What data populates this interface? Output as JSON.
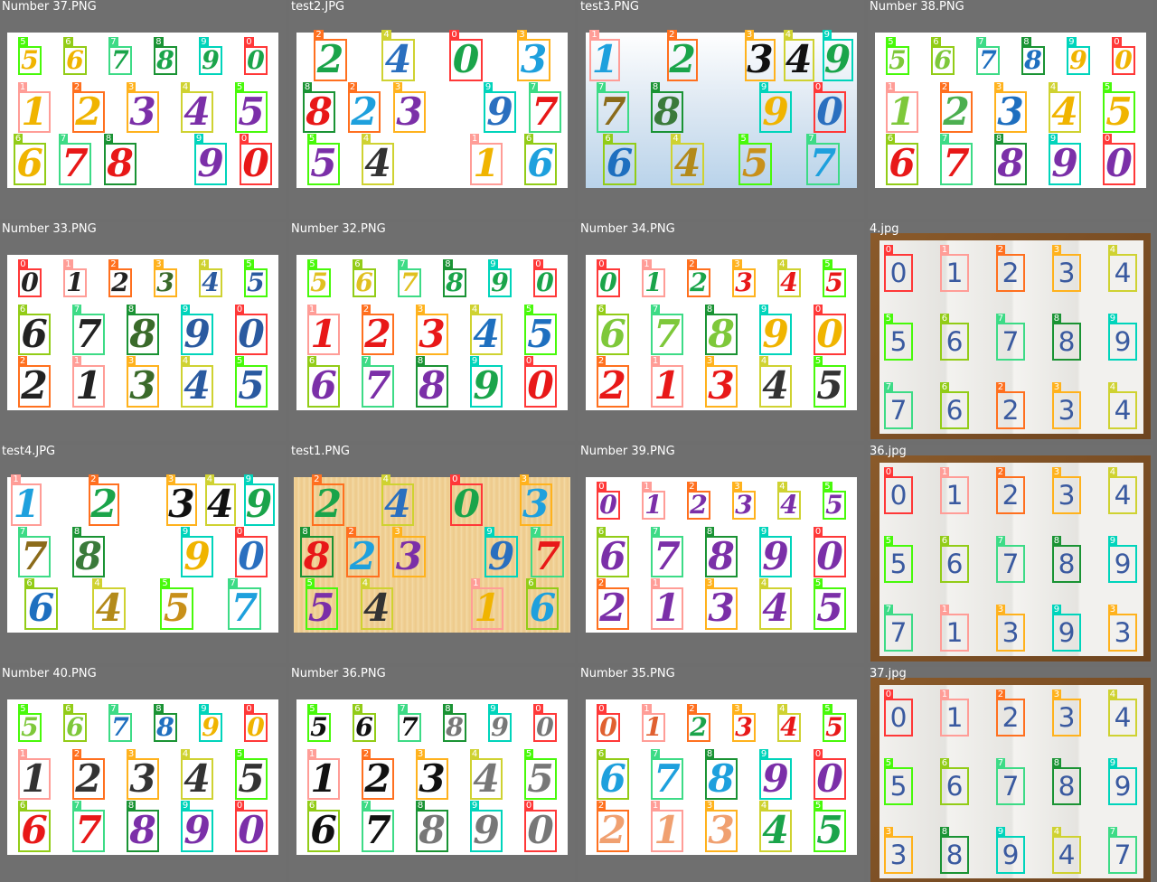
{
  "palette": {
    "0": "#ff3838",
    "1": "#ff9d97",
    "2": "#ff701f",
    "3": "#ffb21d",
    "4": "#cfd231",
    "5": "#48f90a",
    "6": "#92cc17",
    "7": "#3ddb86",
    "8": "#1a9334",
    "9": "#00d4bb"
  },
  "tiles": [
    {
      "title": "Number 37.PNG",
      "bg": "white",
      "style": "print",
      "rows": [
        {
          "d": "567890",
          "big": false
        },
        {
          "d": "12345",
          "big": true
        },
        {
          "d": "678 90",
          "big": true
        }
      ],
      "colors": [
        "#f0b400",
        "#f0b400",
        "#1aa44a",
        "#1aa44a",
        "#1aa44a",
        "#1aa44a",
        "#f0b400",
        "#f0b400",
        "#7b2fa8",
        "#7b2fa8",
        "#7b2fa8",
        "#f0b400",
        "#e81818",
        "#e81818",
        "#7b2fa8",
        "#e81818"
      ]
    },
    {
      "title": "test2.JPG",
      "bg": "white",
      "style": "print",
      "rows": [
        {
          "d": "2403",
          "big": true
        },
        {
          "d": "823 97",
          "big": true
        },
        {
          "d": "54 16",
          "big": true
        }
      ],
      "colors": [
        "#1aa44a",
        "#2a6fbf",
        "#1aa44a",
        "#1ea0dd",
        "#e81818",
        "#1ea0dd",
        "#7b2fa8",
        "#2a6fbf",
        "#e81818",
        "#7b2fa8",
        "#333333",
        "#f0b400",
        "#1ea0dd"
      ]
    },
    {
      "title": "test3.PNG",
      "bg": "gradient",
      "style": "print",
      "rows": [
        {
          "d": "1 2 349",
          "big": true
        },
        {
          "d": "78 90",
          "big": true
        },
        {
          "d": "6457",
          "big": true
        }
      ],
      "colors": [
        "#1ea0dd",
        "#1aa44a",
        "#111111",
        "#111111",
        "#1aa44a",
        "#8b6b1a",
        "#3a7a3a",
        "#f0b400",
        "#2a6fbf",
        "#1e6fbf",
        "#b38a1a",
        "#c8901a",
        "#1ea0dd"
      ]
    },
    {
      "title": "Number 38.PNG",
      "bg": "white",
      "style": "print",
      "rows": [
        {
          "d": "567890",
          "big": false
        },
        {
          "d": "12345",
          "big": true
        },
        {
          "d": "67890",
          "big": true
        }
      ],
      "colors": [
        "#7ec83a",
        "#7ec83a",
        "#1e6fbf",
        "#1e6fbf",
        "#f0b400",
        "#f0b400",
        "#7ec83a",
        "#4caf50",
        "#1e6fbf",
        "#f0b400",
        "#f0b400",
        "#e81818",
        "#e81818",
        "#7b2fa8",
        "#7b2fa8",
        "#7b2fa8"
      ]
    },
    {
      "title": "Number 33.PNG",
      "bg": "white",
      "style": "print",
      "rows": [
        {
          "d": "012345",
          "big": false
        },
        {
          "d": "67890",
          "big": true
        },
        {
          "d": "21345",
          "big": true
        }
      ],
      "colors": [
        "#222222",
        "#222222",
        "#222222",
        "#3a6a2a",
        "#2a5aa0",
        "#2a5aa0",
        "#222222",
        "#222222",
        "#3a6a2a",
        "#2a5aa0",
        "#2a5aa0",
        "#222222",
        "#222222",
        "#3a6a2a",
        "#2a5aa0",
        "#2a5aa0"
      ]
    },
    {
      "title": "Number 32.PNG",
      "bg": "white",
      "style": "print",
      "rows": [
        {
          "d": "567890",
          "big": false
        },
        {
          "d": "12345",
          "big": true
        },
        {
          "d": "67890",
          "big": true
        }
      ],
      "colors": [
        "#e0c020",
        "#e0c020",
        "#e0c020",
        "#1aa44a",
        "#1aa44a",
        "#1aa44a",
        "#e81818",
        "#e81818",
        "#e81818",
        "#1e6fbf",
        "#1e6fbf",
        "#7b2fa8",
        "#7b2fa8",
        "#7b2fa8",
        "#1aa44a",
        "#e81818"
      ]
    },
    {
      "title": "Number 34.PNG",
      "bg": "white",
      "style": "print",
      "rows": [
        {
          "d": "012345",
          "big": false
        },
        {
          "d": "67890",
          "big": true
        },
        {
          "d": "21345",
          "big": true
        }
      ],
      "colors": [
        "#1aa44a",
        "#1aa44a",
        "#1aa44a",
        "#e81818",
        "#e81818",
        "#e81818",
        "#7ec83a",
        "#7ec83a",
        "#7ec83a",
        "#f0b400",
        "#f0b400",
        "#e81818",
        "#e81818",
        "#e81818",
        "#333333",
        "#333333"
      ]
    },
    {
      "title": "4.jpg",
      "bg": "paper",
      "style": "hand",
      "rows": [
        {
          "d": "01234",
          "big": false
        },
        {
          "d": "56789",
          "big": false
        },
        {
          "d": "76234",
          "big": false
        }
      ],
      "colors": [
        "#3a5aa0",
        "#3a5aa0",
        "#3a5aa0",
        "#3a5aa0",
        "#3a5aa0",
        "#3a5aa0",
        "#3a5aa0",
        "#3a5aa0",
        "#3a5aa0",
        "#3a5aa0",
        "#3a5aa0",
        "#3a5aa0",
        "#3a5aa0",
        "#3a5aa0",
        "#3a5aa0"
      ]
    },
    {
      "title": "test4.JPG",
      "bg": "white",
      "style": "print",
      "rows": [
        {
          "d": "1 2 349",
          "big": true
        },
        {
          "d": "78 90",
          "big": true
        },
        {
          "d": "6457",
          "big": true
        }
      ],
      "colors": [
        "#1ea0dd",
        "#1aa44a",
        "#111111",
        "#111111",
        "#1aa44a",
        "#8b6b1a",
        "#3a7a3a",
        "#f0b400",
        "#2a6fbf",
        "#1e6fbf",
        "#b38a1a",
        "#c8901a",
        "#1ea0dd"
      ]
    },
    {
      "title": "test1.PNG",
      "bg": "canvas",
      "style": "print",
      "rows": [
        {
          "d": "2403",
          "big": true
        },
        {
          "d": "823 97",
          "big": true
        },
        {
          "d": "54 16",
          "big": true
        }
      ],
      "colors": [
        "#1aa44a",
        "#2a6fbf",
        "#1aa44a",
        "#1ea0dd",
        "#e81818",
        "#1ea0dd",
        "#7b2fa8",
        "#2a6fbf",
        "#e81818",
        "#7b2fa8",
        "#333333",
        "#f0b400",
        "#1ea0dd"
      ]
    },
    {
      "title": "Number 39.PNG",
      "bg": "white",
      "style": "print",
      "rows": [
        {
          "d": "012345",
          "big": false
        },
        {
          "d": "67890",
          "big": true
        },
        {
          "d": "21345",
          "big": true
        }
      ],
      "colors": [
        "#7b2fa8",
        "#7b2fa8",
        "#7b2fa8",
        "#7b2fa8",
        "#7b2fa8",
        "#7b2fa8",
        "#7b2fa8",
        "#7b2fa8",
        "#7b2fa8",
        "#7b2fa8",
        "#7b2fa8",
        "#7b2fa8",
        "#7b2fa8",
        "#7b2fa8",
        "#7b2fa8",
        "#7b2fa8"
      ]
    },
    {
      "title": "36.jpg",
      "bg": "paper",
      "style": "hand",
      "rows": [
        {
          "d": "01234",
          "big": false
        },
        {
          "d": "56789",
          "big": false
        },
        {
          "d": "71393",
          "big": false
        }
      ],
      "colors": [
        "#3a5aa0",
        "#3a5aa0",
        "#3a5aa0",
        "#3a5aa0",
        "#3a5aa0",
        "#3a5aa0",
        "#3a5aa0",
        "#3a5aa0",
        "#3a5aa0",
        "#3a5aa0",
        "#3a5aa0",
        "#3a5aa0",
        "#3a5aa0",
        "#3a5aa0",
        "#3a5aa0"
      ]
    },
    {
      "title": "Number 40.PNG",
      "bg": "white",
      "style": "print",
      "rows": [
        {
          "d": "567890",
          "big": false
        },
        {
          "d": "12345",
          "big": true
        },
        {
          "d": "67890",
          "big": true
        }
      ],
      "colors": [
        "#7ec83a",
        "#7ec83a",
        "#1e6fbf",
        "#1e6fbf",
        "#f0b400",
        "#f0b400",
        "#333333",
        "#333333",
        "#333333",
        "#333333",
        "#333333",
        "#e81818",
        "#e81818",
        "#7b2fa8",
        "#7b2fa8",
        "#7b2fa8"
      ]
    },
    {
      "title": "Number 36.PNG",
      "bg": "white",
      "style": "print",
      "rows": [
        {
          "d": "567890",
          "big": false
        },
        {
          "d": "12345",
          "big": true
        },
        {
          "d": "67890",
          "big": true
        }
      ],
      "colors": [
        "#111111",
        "#111111",
        "#111111",
        "#777777",
        "#777777",
        "#777777",
        "#111111",
        "#111111",
        "#111111",
        "#777777",
        "#777777",
        "#111111",
        "#111111",
        "#777777",
        "#777777",
        "#777777"
      ]
    },
    {
      "title": "Number 35.PNG",
      "bg": "white",
      "style": "print",
      "rows": [
        {
          "d": "012345",
          "big": false
        },
        {
          "d": "67890",
          "big": true
        },
        {
          "d": "21345",
          "big": true
        }
      ],
      "colors": [
        "#e06030",
        "#e06030",
        "#1aa44a",
        "#e81818",
        "#e81818",
        "#e81818",
        "#1ea0dd",
        "#1ea0dd",
        "#1ea0dd",
        "#7b2fa8",
        "#7b2fa8",
        "#f0a070",
        "#f0a070",
        "#f0a070",
        "#1aa44a",
        "#1aa44a"
      ]
    },
    {
      "title": "37.jpg",
      "bg": "paper",
      "style": "hand",
      "rows": [
        {
          "d": "01234",
          "big": false
        },
        {
          "d": "56789",
          "big": false
        },
        {
          "d": "38947",
          "big": false
        }
      ],
      "colors": [
        "#3a5aa0",
        "#3a5aa0",
        "#3a5aa0",
        "#3a5aa0",
        "#3a5aa0",
        "#3a5aa0",
        "#3a5aa0",
        "#3a5aa0",
        "#3a5aa0",
        "#3a5aa0",
        "#3a5aa0",
        "#3a5aa0",
        "#3a5aa0",
        "#3a5aa0",
        "#3a5aa0"
      ]
    }
  ]
}
